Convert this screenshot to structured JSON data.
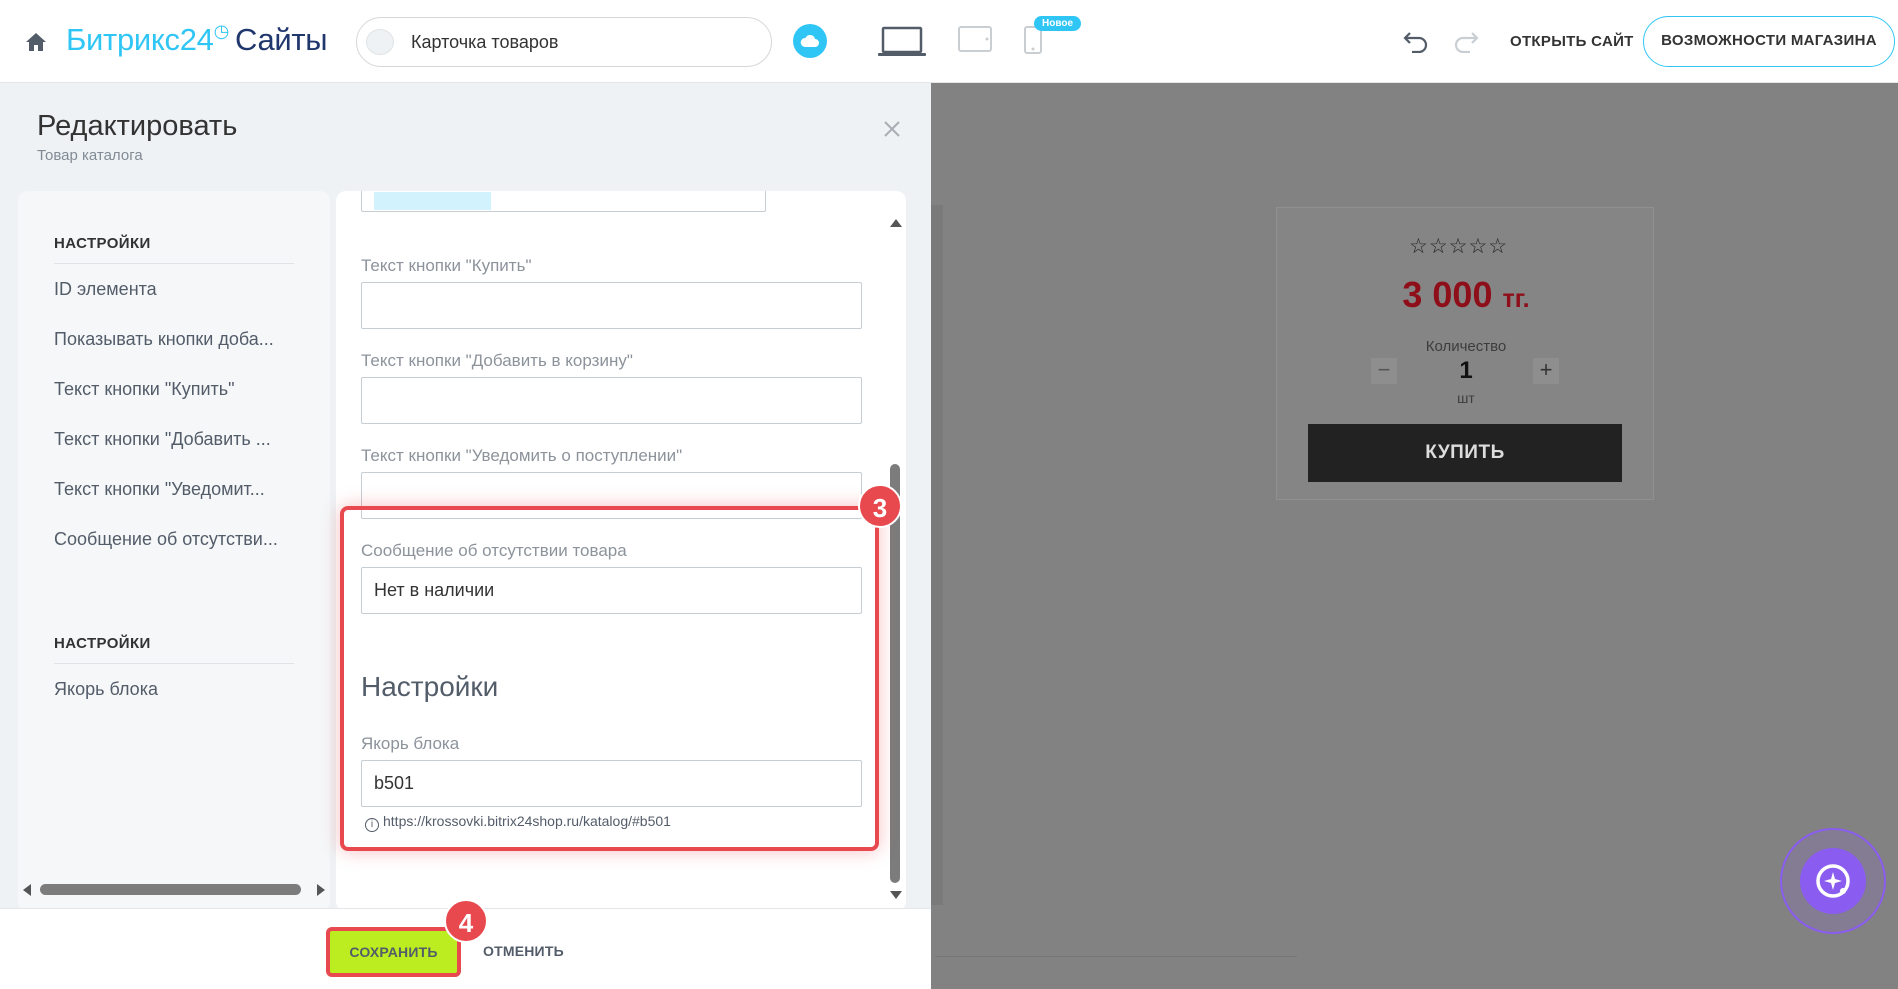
{
  "topbar": {
    "logo_brand": "Битрикс24",
    "logo_clock": "◷",
    "logo_product": "Сайты",
    "page_name": "Карточка товаров",
    "new_badge": "Новое",
    "open_site": "ОТКРЫТЬ САЙТ",
    "store_features": "ВОЗМОЖНОСТИ МАГАЗИНА",
    "icons": [
      "home-icon",
      "cloud-icon",
      "desktop-icon",
      "tablet-icon",
      "mobile-icon",
      "undo-icon",
      "redo-icon"
    ]
  },
  "panel": {
    "title": "Редактировать",
    "subtitle": "Товар каталога",
    "nav": {
      "sections": [
        {
          "heading": "НАСТРОЙКИ",
          "items": [
            "ID элемента",
            "Показывать кнопки доба...",
            "Текст кнопки \"Купить\"",
            "Текст кнопки \"Добавить ...",
            "Текст кнопки \"Уведомит...",
            "Сообщение об отсутстви..."
          ]
        },
        {
          "heading": "НАСТРОЙКИ",
          "items": [
            "Якорь блока"
          ]
        }
      ]
    },
    "form": {
      "fields": [
        {
          "label": "Текст кнопки \"Купить\"",
          "value": ""
        },
        {
          "label": "Текст кнопки \"Добавить в корзину\"",
          "value": ""
        },
        {
          "label": "Текст кнопки \"Уведомить о поступлении\"",
          "value": ""
        },
        {
          "label": "Сообщение об отсутствии товара",
          "value": "Нет в наличии"
        }
      ],
      "section_title": "Настройки",
      "anchor_label": "Якорь блока",
      "anchor_value": "b501",
      "anchor_hint": "https://krossovki.bitrix24shop.ru/katalog/#b501"
    },
    "save_label": "СОХРАНИТЬ",
    "cancel_label": "ОТМЕНИТЬ",
    "step_badges": [
      "3",
      "4"
    ],
    "highlight_color": "#e8494e"
  },
  "preview": {
    "stars": "☆☆☆☆☆",
    "price_value": "3 000",
    "price_currency": "тг.",
    "quantity_label": "Количество",
    "quantity_value": "1",
    "quantity_unit": "шт",
    "minus": "−",
    "plus": "+",
    "buy_label": "КУПИТЬ"
  },
  "colors": {
    "accent": "#2fc6f6",
    "save_green": "#bbed21",
    "price_red": "#8e0e19",
    "assistant_purple": "#8a5cf0"
  }
}
